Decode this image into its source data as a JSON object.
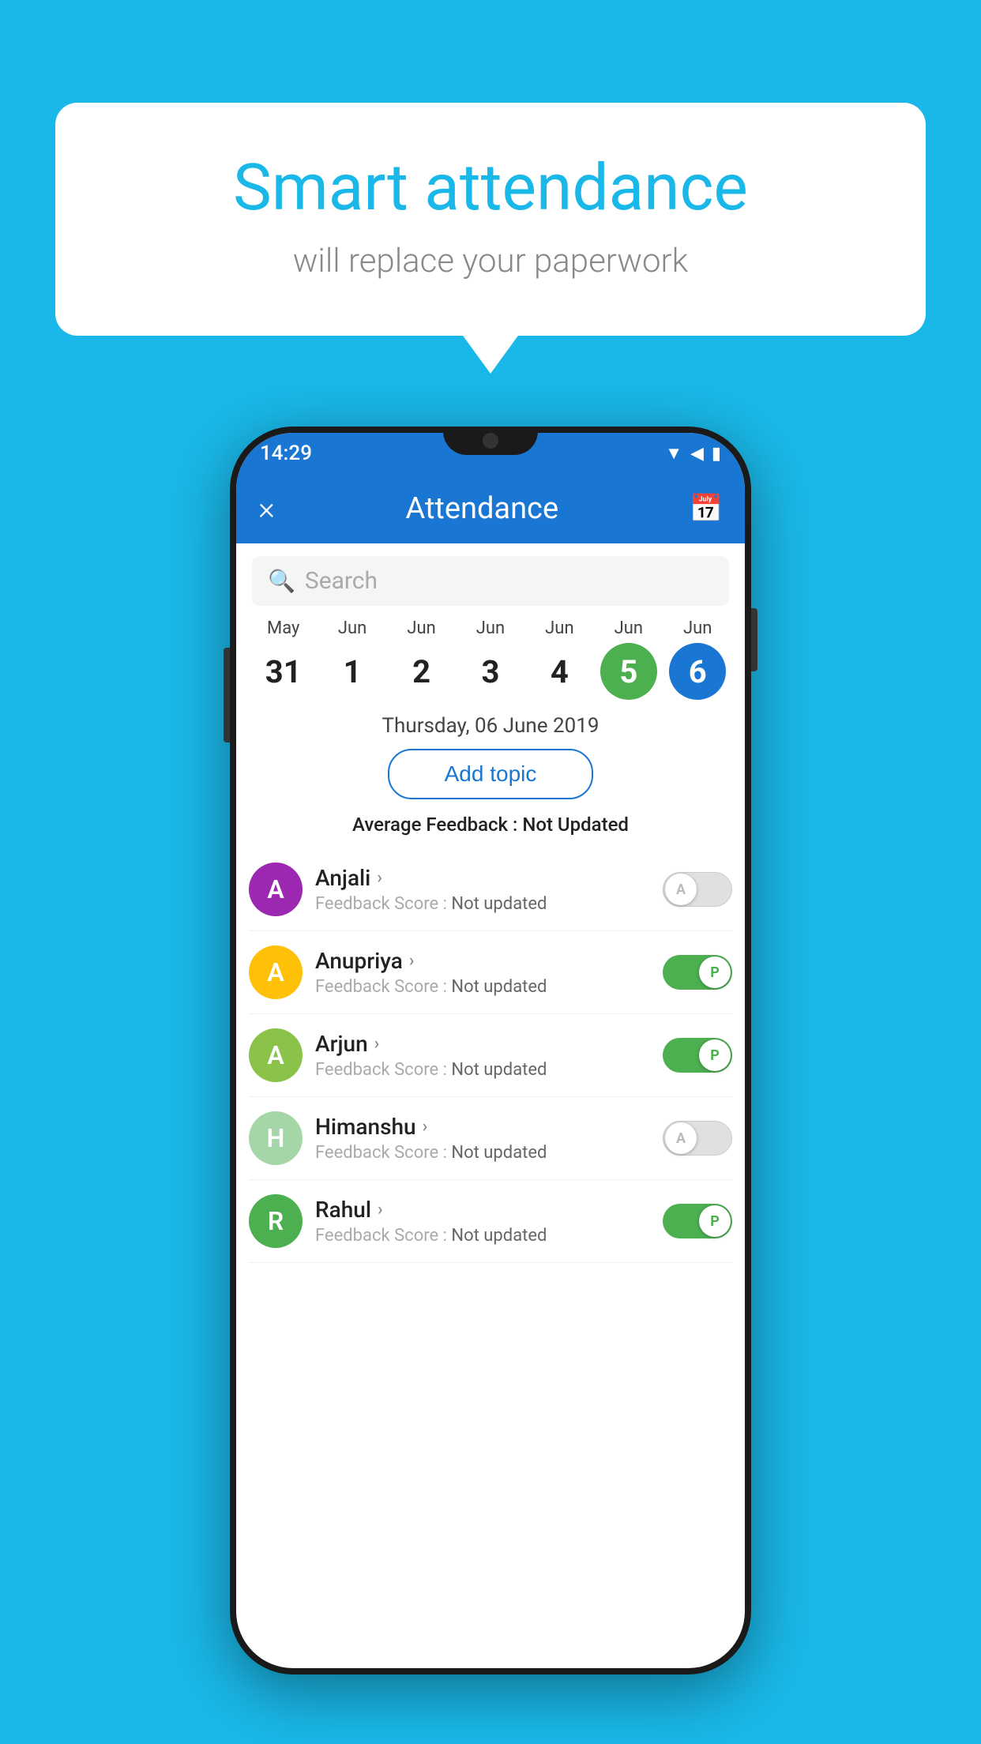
{
  "background": {
    "color": "#1ab8e8"
  },
  "speech_bubble": {
    "title": "Smart attendance",
    "subtitle": "will replace your paperwork"
  },
  "phone": {
    "status_bar": {
      "time": "14:29",
      "icons": [
        "wifi",
        "signal",
        "battery"
      ]
    },
    "app_bar": {
      "close_label": "×",
      "title": "Attendance",
      "calendar_icon": "📅"
    },
    "search": {
      "placeholder": "Search"
    },
    "calendar": {
      "days": [
        {
          "month": "May",
          "date": "31",
          "style": "normal"
        },
        {
          "month": "Jun",
          "date": "1",
          "style": "normal"
        },
        {
          "month": "Jun",
          "date": "2",
          "style": "normal"
        },
        {
          "month": "Jun",
          "date": "3",
          "style": "normal"
        },
        {
          "month": "Jun",
          "date": "4",
          "style": "normal"
        },
        {
          "month": "Jun",
          "date": "5",
          "style": "green"
        },
        {
          "month": "Jun",
          "date": "6",
          "style": "blue"
        }
      ]
    },
    "selected_date": "Thursday, 06 June 2019",
    "add_topic_label": "Add topic",
    "avg_feedback_label": "Average Feedback : ",
    "avg_feedback_value": "Not Updated",
    "students": [
      {
        "name": "Anjali",
        "initial": "A",
        "avatar_color": "#9c27b0",
        "feedback_label": "Feedback Score : ",
        "feedback_value": "Not updated",
        "toggle_state": "off",
        "toggle_label": "A"
      },
      {
        "name": "Anupriya",
        "initial": "A",
        "avatar_color": "#ffc107",
        "feedback_label": "Feedback Score : ",
        "feedback_value": "Not updated",
        "toggle_state": "on",
        "toggle_label": "P"
      },
      {
        "name": "Arjun",
        "initial": "A",
        "avatar_color": "#8bc34a",
        "feedback_label": "Feedback Score : ",
        "feedback_value": "Not updated",
        "toggle_state": "on",
        "toggle_label": "P"
      },
      {
        "name": "Himanshu",
        "initial": "H",
        "avatar_color": "#a5d6a7",
        "feedback_label": "Feedback Score : ",
        "feedback_value": "Not updated",
        "toggle_state": "off",
        "toggle_label": "A"
      },
      {
        "name": "Rahul",
        "initial": "R",
        "avatar_color": "#4caf50",
        "feedback_label": "Feedback Score : ",
        "feedback_value": "Not updated",
        "toggle_state": "on",
        "toggle_label": "P"
      }
    ]
  }
}
